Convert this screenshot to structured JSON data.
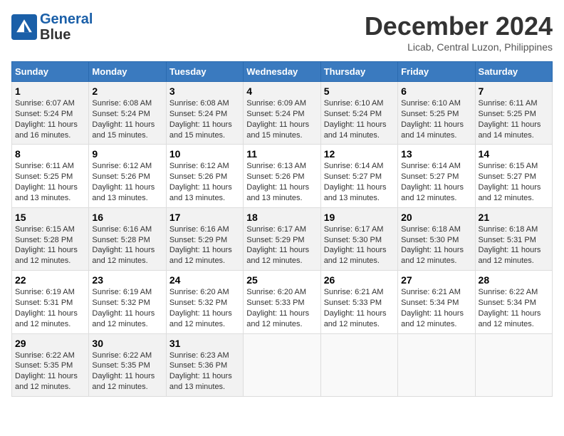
{
  "logo": {
    "line1": "General",
    "line2": "Blue"
  },
  "title": "December 2024",
  "location": "Licab, Central Luzon, Philippines",
  "weekdays": [
    "Sunday",
    "Monday",
    "Tuesday",
    "Wednesday",
    "Thursday",
    "Friday",
    "Saturday"
  ],
  "weeks": [
    [
      {
        "day": "1",
        "sunrise": "6:07 AM",
        "sunset": "5:24 PM",
        "daylight": "11 hours and 16 minutes."
      },
      {
        "day": "2",
        "sunrise": "6:08 AM",
        "sunset": "5:24 PM",
        "daylight": "11 hours and 15 minutes."
      },
      {
        "day": "3",
        "sunrise": "6:08 AM",
        "sunset": "5:24 PM",
        "daylight": "11 hours and 15 minutes."
      },
      {
        "day": "4",
        "sunrise": "6:09 AM",
        "sunset": "5:24 PM",
        "daylight": "11 hours and 15 minutes."
      },
      {
        "day": "5",
        "sunrise": "6:10 AM",
        "sunset": "5:24 PM",
        "daylight": "11 hours and 14 minutes."
      },
      {
        "day": "6",
        "sunrise": "6:10 AM",
        "sunset": "5:25 PM",
        "daylight": "11 hours and 14 minutes."
      },
      {
        "day": "7",
        "sunrise": "6:11 AM",
        "sunset": "5:25 PM",
        "daylight": "11 hours and 14 minutes."
      }
    ],
    [
      {
        "day": "8",
        "sunrise": "6:11 AM",
        "sunset": "5:25 PM",
        "daylight": "11 hours and 13 minutes."
      },
      {
        "day": "9",
        "sunrise": "6:12 AM",
        "sunset": "5:26 PM",
        "daylight": "11 hours and 13 minutes."
      },
      {
        "day": "10",
        "sunrise": "6:12 AM",
        "sunset": "5:26 PM",
        "daylight": "11 hours and 13 minutes."
      },
      {
        "day": "11",
        "sunrise": "6:13 AM",
        "sunset": "5:26 PM",
        "daylight": "11 hours and 13 minutes."
      },
      {
        "day": "12",
        "sunrise": "6:14 AM",
        "sunset": "5:27 PM",
        "daylight": "11 hours and 13 minutes."
      },
      {
        "day": "13",
        "sunrise": "6:14 AM",
        "sunset": "5:27 PM",
        "daylight": "11 hours and 12 minutes."
      },
      {
        "day": "14",
        "sunrise": "6:15 AM",
        "sunset": "5:27 PM",
        "daylight": "11 hours and 12 minutes."
      }
    ],
    [
      {
        "day": "15",
        "sunrise": "6:15 AM",
        "sunset": "5:28 PM",
        "daylight": "11 hours and 12 minutes."
      },
      {
        "day": "16",
        "sunrise": "6:16 AM",
        "sunset": "5:28 PM",
        "daylight": "11 hours and 12 minutes."
      },
      {
        "day": "17",
        "sunrise": "6:16 AM",
        "sunset": "5:29 PM",
        "daylight": "11 hours and 12 minutes."
      },
      {
        "day": "18",
        "sunrise": "6:17 AM",
        "sunset": "5:29 PM",
        "daylight": "11 hours and 12 minutes."
      },
      {
        "day": "19",
        "sunrise": "6:17 AM",
        "sunset": "5:30 PM",
        "daylight": "11 hours and 12 minutes."
      },
      {
        "day": "20",
        "sunrise": "6:18 AM",
        "sunset": "5:30 PM",
        "daylight": "11 hours and 12 minutes."
      },
      {
        "day": "21",
        "sunrise": "6:18 AM",
        "sunset": "5:31 PM",
        "daylight": "11 hours and 12 minutes."
      }
    ],
    [
      {
        "day": "22",
        "sunrise": "6:19 AM",
        "sunset": "5:31 PM",
        "daylight": "11 hours and 12 minutes."
      },
      {
        "day": "23",
        "sunrise": "6:19 AM",
        "sunset": "5:32 PM",
        "daylight": "11 hours and 12 minutes."
      },
      {
        "day": "24",
        "sunrise": "6:20 AM",
        "sunset": "5:32 PM",
        "daylight": "11 hours and 12 minutes."
      },
      {
        "day": "25",
        "sunrise": "6:20 AM",
        "sunset": "5:33 PM",
        "daylight": "11 hours and 12 minutes."
      },
      {
        "day": "26",
        "sunrise": "6:21 AM",
        "sunset": "5:33 PM",
        "daylight": "11 hours and 12 minutes."
      },
      {
        "day": "27",
        "sunrise": "6:21 AM",
        "sunset": "5:34 PM",
        "daylight": "11 hours and 12 minutes."
      },
      {
        "day": "28",
        "sunrise": "6:22 AM",
        "sunset": "5:34 PM",
        "daylight": "11 hours and 12 minutes."
      }
    ],
    [
      {
        "day": "29",
        "sunrise": "6:22 AM",
        "sunset": "5:35 PM",
        "daylight": "11 hours and 12 minutes."
      },
      {
        "day": "30",
        "sunrise": "6:22 AM",
        "sunset": "5:35 PM",
        "daylight": "11 hours and 12 minutes."
      },
      {
        "day": "31",
        "sunrise": "6:23 AM",
        "sunset": "5:36 PM",
        "daylight": "11 hours and 13 minutes."
      },
      null,
      null,
      null,
      null
    ]
  ]
}
